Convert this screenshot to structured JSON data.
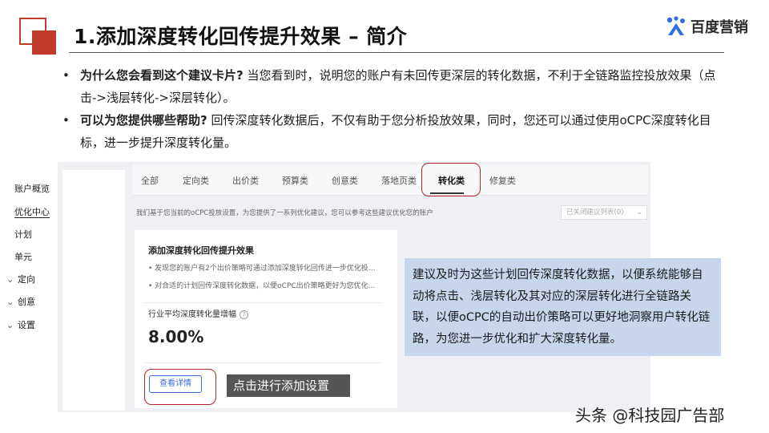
{
  "slide": {
    "title": "1.添加深度转化回传提升效果 – 简介",
    "brand": "百度营销",
    "accent_color": "#c0392b"
  },
  "bullets": [
    {
      "bold": "为什么您会看到这个建议卡片?",
      "text": " 当您看到时，说明您的账户有未回传更深层的转化数据，不利于全链路监控投放效果（点击->浅层转化->深层转化）。"
    },
    {
      "bold": "可以为您提供哪些帮助?",
      "text": " 回传深度转化数据后，不仅有助于您分析投放效果，同时，您还可以通过使用oCPC深度转化目标，进一步提升深度转化量。"
    }
  ],
  "side_nav": {
    "items": [
      {
        "label": "账户概览",
        "chevron": false,
        "active": false
      },
      {
        "label": "优化中心",
        "chevron": false,
        "active": true
      },
      {
        "label": "计划",
        "chevron": false,
        "active": false
      },
      {
        "label": "单元",
        "chevron": false,
        "active": false
      },
      {
        "label": "定向",
        "chevron": true,
        "active": false
      },
      {
        "label": "创意",
        "chevron": true,
        "active": false
      },
      {
        "label": "设置",
        "chevron": true,
        "active": false
      }
    ]
  },
  "tabs": [
    {
      "label": "全部",
      "active": false
    },
    {
      "label": "定向类",
      "active": false
    },
    {
      "label": "出价类",
      "active": false
    },
    {
      "label": "预算类",
      "active": false
    },
    {
      "label": "创意类",
      "active": false
    },
    {
      "label": "落地页类",
      "active": false
    },
    {
      "label": "转化类",
      "active": true
    },
    {
      "label": "修复类",
      "active": false
    }
  ],
  "info_line": "我们基于您当前的oCPC投放设置，为您提供了一系列优化建议，您可以参考这些建议优化您的账户",
  "closed_select": "已关闭建议列表(0)",
  "card": {
    "title": "添加深度转化回传提升效果",
    "lines": [
      "• 发现您的账户有2个出价策略可通过添加深度转化回传进一步优化投...",
      "• 对合适的计划回传深度转化数据，以便oCPC出价策略更好为您优化..."
    ],
    "metric_label": "行业平均深度转化量增幅",
    "metric_value": "8.00%",
    "button_label": "查看详情"
  },
  "callout": "点击进行添加设置",
  "explanation": "建议及时为这些计划回传深度转化数据，以便系统能够自动将点击、浅层转化及其对应的深层转化进行全链路关联，以便oCPC的自动出价策略可以更好地洞察用户转化链路，为您进一步优化和扩大深度转化量。",
  "watermark": "头条 @科技园广告部",
  "icons": {
    "brand": "brand-logo-icon",
    "help": "help-circle-icon",
    "caret": "chevron-down-icon"
  }
}
